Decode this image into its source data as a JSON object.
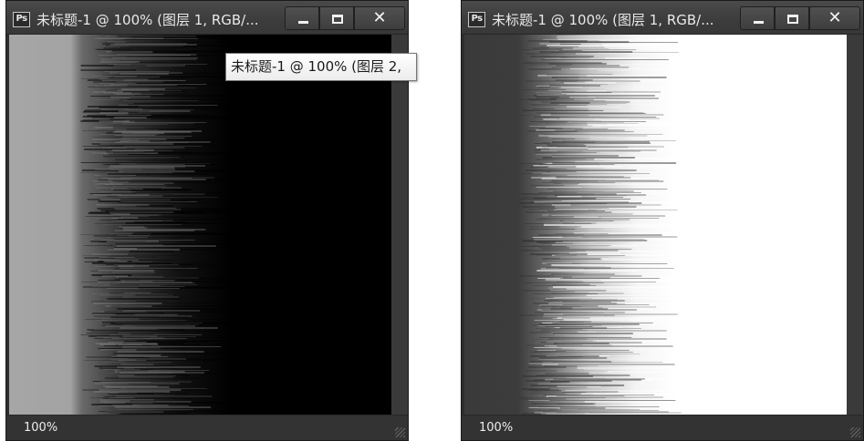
{
  "left_window": {
    "app_icon": "Ps",
    "title": "未标题-1 @ 100% (图层 1, RGB/...",
    "zoom": "100%",
    "tooltip": "未标题-1 @ 100% (图层 2,",
    "gradient": "light gray → streaked transition → black"
  },
  "right_window": {
    "app_icon": "Ps",
    "title": "未标题-1 @ 100% (图层 1, RGB/...",
    "zoom": "100%",
    "gradient": "dark gray → streaked transition → white"
  },
  "colors": {
    "chrome": "#2f2f2f",
    "left_canvas_start": "#a6a6a6",
    "left_canvas_end": "#000000",
    "right_canvas_start": "#3a3a3a",
    "right_canvas_end": "#ffffff"
  },
  "icons": [
    "ps-logo-icon",
    "minimize-icon",
    "maximize-icon",
    "close-icon",
    "resize-grip-icon"
  ]
}
